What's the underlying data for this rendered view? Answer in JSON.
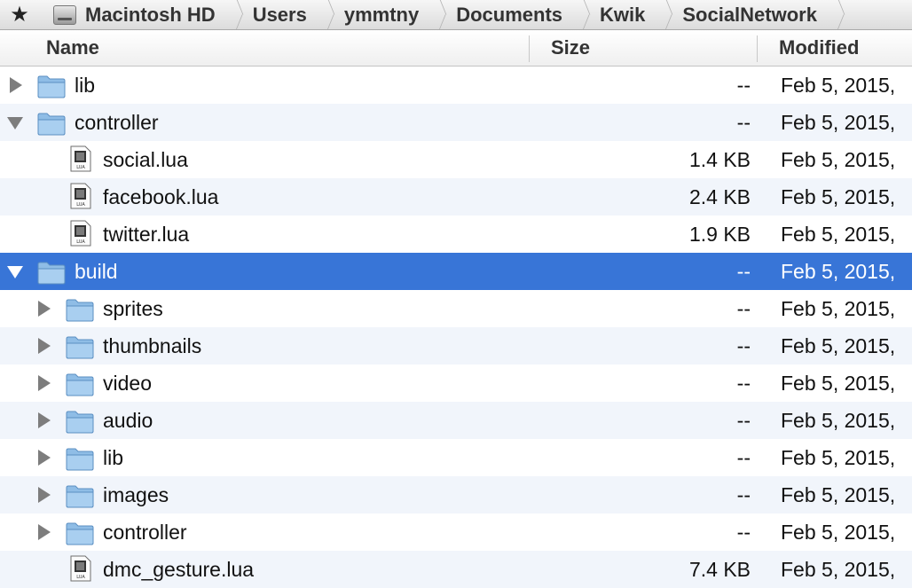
{
  "pathbar": {
    "favorite_icon": "star-icon",
    "crumbs": [
      "Macintosh HD",
      "Users",
      "ymmtny",
      "Documents",
      "Kwik",
      "SocialNetwork"
    ]
  },
  "columns": {
    "name": "Name",
    "size": "Size",
    "modified": "Modified"
  },
  "colors": {
    "selection": "#3875d7",
    "alt_row": "#f1f5fb"
  },
  "rows": [
    {
      "name": "lib",
      "size": "--",
      "modified": "Feb 5, 2015,",
      "type": "folder",
      "depth": 0,
      "disclosure": "collapsed"
    },
    {
      "name": "controller",
      "size": "--",
      "modified": "Feb 5, 2015,",
      "type": "folder",
      "depth": 0,
      "disclosure": "expanded"
    },
    {
      "name": "social.lua",
      "size": "1.4 KB",
      "modified": "Feb 5, 2015,",
      "type": "file",
      "depth": 1
    },
    {
      "name": "facebook.lua",
      "size": "2.4 KB",
      "modified": "Feb 5, 2015,",
      "type": "file",
      "depth": 1
    },
    {
      "name": "twitter.lua",
      "size": "1.9 KB",
      "modified": "Feb 5, 2015,",
      "type": "file",
      "depth": 1
    },
    {
      "name": "build",
      "size": "--",
      "modified": "Feb 5, 2015,",
      "type": "folder",
      "depth": 0,
      "disclosure": "expanded",
      "selected": true
    },
    {
      "name": "sprites",
      "size": "--",
      "modified": "Feb 5, 2015,",
      "type": "folder",
      "depth": 1,
      "disclosure": "collapsed"
    },
    {
      "name": "thumbnails",
      "size": "--",
      "modified": "Feb 5, 2015,",
      "type": "folder",
      "depth": 1,
      "disclosure": "collapsed"
    },
    {
      "name": "video",
      "size": "--",
      "modified": "Feb 5, 2015,",
      "type": "folder",
      "depth": 1,
      "disclosure": "collapsed"
    },
    {
      "name": "audio",
      "size": "--",
      "modified": "Feb 5, 2015,",
      "type": "folder",
      "depth": 1,
      "disclosure": "collapsed"
    },
    {
      "name": "lib",
      "size": "--",
      "modified": "Feb 5, 2015,",
      "type": "folder",
      "depth": 1,
      "disclosure": "collapsed"
    },
    {
      "name": "images",
      "size": "--",
      "modified": "Feb 5, 2015,",
      "type": "folder",
      "depth": 1,
      "disclosure": "collapsed"
    },
    {
      "name": "controller",
      "size": "--",
      "modified": "Feb 5, 2015,",
      "type": "folder",
      "depth": 1,
      "disclosure": "collapsed"
    },
    {
      "name": "dmc_gesture.lua",
      "size": "7.4 KB",
      "modified": "Feb 5, 2015,",
      "type": "file",
      "depth": 1
    }
  ]
}
